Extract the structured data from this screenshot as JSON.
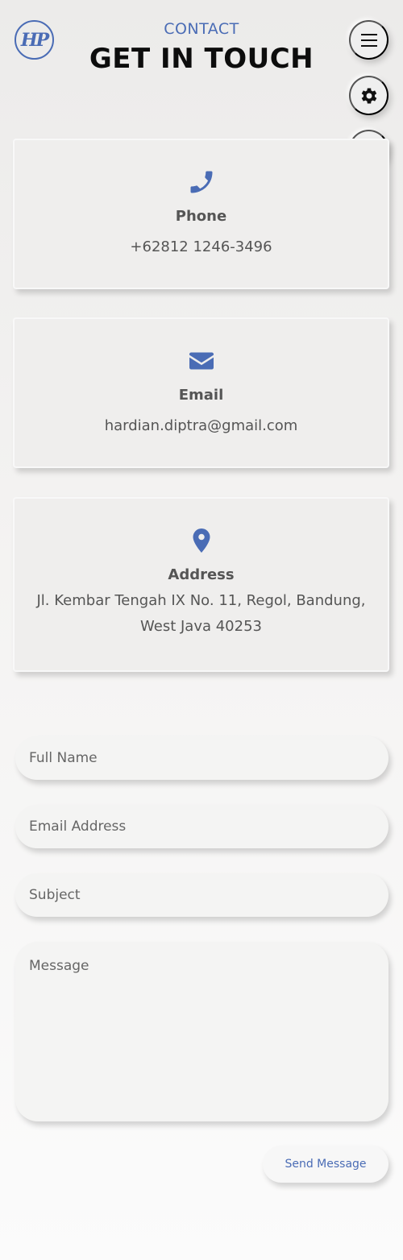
{
  "header": {
    "logo_text": "HP",
    "eyebrow": "CONTACT",
    "title": "GET IN TOUCH"
  },
  "fabs": [
    {
      "icon": "menu-icon"
    },
    {
      "icon": "gear-icon"
    },
    {
      "icon": "moon-icon"
    }
  ],
  "cards": {
    "phone": {
      "icon": "phone-icon",
      "label": "Phone",
      "value": "+62812 1246-3496"
    },
    "email": {
      "icon": "envelope-icon",
      "label": "Email",
      "value": "hardian.diptra@gmail.com"
    },
    "address": {
      "icon": "map-pin-icon",
      "label": "Address",
      "line1": "Jl. Kembar Tengah IX No. 11, Regol, Bandung,",
      "line2": "West Java 40253"
    }
  },
  "form": {
    "name_placeholder": "Full Name",
    "email_placeholder": "Email Address",
    "subject_placeholder": "Subject",
    "message_placeholder": "Message",
    "submit_label": "Send Message"
  },
  "colors": {
    "accent": "#4a6cb5",
    "title": "#0d0d0d",
    "text": "#555555"
  }
}
